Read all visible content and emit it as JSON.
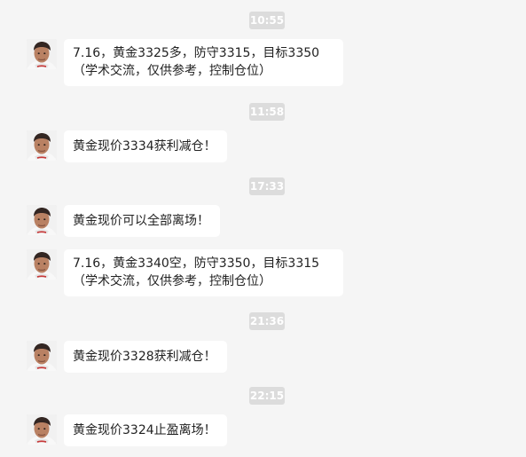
{
  "messages": [
    {
      "time": "10:55",
      "text": "7.16，黄金3325多，防守3315，目标3350（学术交流，仅供参考，控制仓位）"
    },
    {
      "time": "11:58",
      "text": "黄金现价3334获利减仓！"
    },
    {
      "time": "17:33",
      "text": "黄金现价可以全部离场！"
    },
    {
      "time": "",
      "text": "7.16，黄金3340空，防守3350，目标3315（学术交流，仅供参考，控制仓位）"
    },
    {
      "time": "21:36",
      "text": "黄金现价3328获利减仓！"
    },
    {
      "time": "22:15",
      "text": "黄金现价3324止盈离场！"
    }
  ]
}
